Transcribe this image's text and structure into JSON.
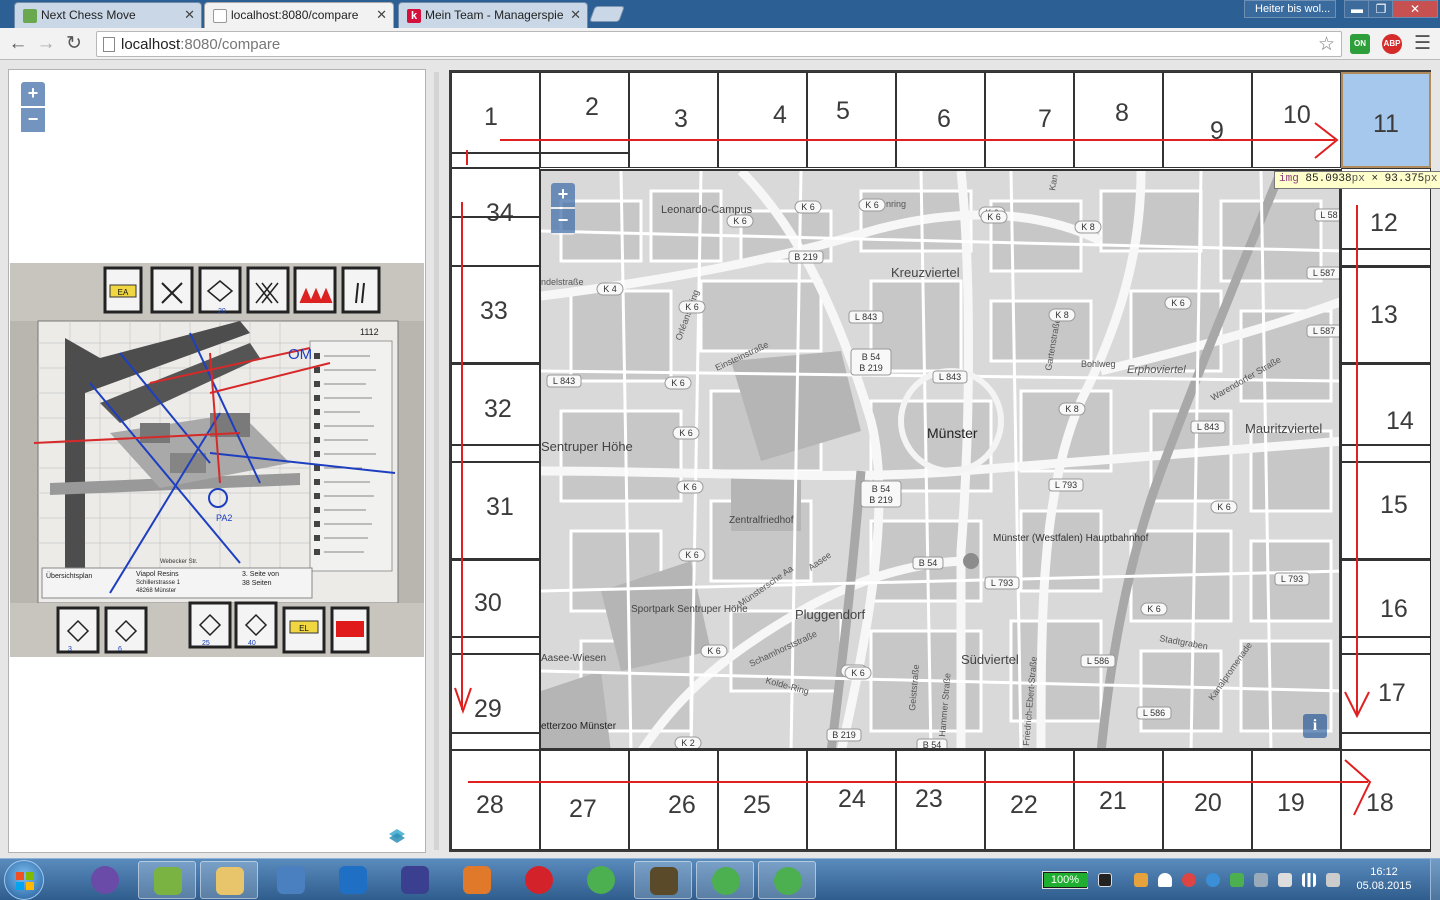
{
  "browser": {
    "tabs": [
      {
        "title": "Next Chess Move",
        "favicon_color": "#6aa84f"
      },
      {
        "title": "localhost:8080/compare",
        "favicon_color": "#ffffff"
      },
      {
        "title": "Mein Team - Managerspie",
        "favicon_color": "#d4113c"
      }
    ],
    "weather": "Heiter bis wol...",
    "window_buttons": {
      "minimize": "▬",
      "maximize": "❐",
      "close": "✕"
    },
    "url_host": "localhost",
    "url_path": ":8080/compare",
    "extensions": [
      "ON",
      "ABP"
    ]
  },
  "left_map": {
    "zoom_in": "+",
    "zoom_out": "−",
    "photo_labels": {
      "plan_number": "1112",
      "overview": "Übersichtsplan",
      "company": "Viapol Resins",
      "street": "Schillerstrasse 1",
      "city": "48268 Münster",
      "page": "3. Seite von",
      "pages": "38 Seiten",
      "card_ea": "EA",
      "card_el": "EL",
      "card_numbers": [
        "20",
        "3",
        "6",
        "25",
        "40"
      ],
      "marker_om": "OM",
      "marker_pa": "PA2",
      "street_label": "Webecker Str."
    }
  },
  "board": {
    "top_numbers": [
      "1",
      "2",
      "3",
      "4",
      "5",
      "6",
      "7",
      "8",
      "9",
      "10",
      "11"
    ],
    "right_numbers": [
      "12",
      "13",
      "14",
      "15",
      "16",
      "17"
    ],
    "bottom_numbers": [
      "28",
      "27",
      "26",
      "25",
      "24",
      "23",
      "22",
      "21",
      "20",
      "19",
      "18"
    ],
    "left_numbers": [
      "34",
      "33",
      "32",
      "31",
      "30",
      "29"
    ],
    "highlight_color": "#a6c8ec",
    "arrow_color": "#e02020"
  },
  "map": {
    "zoom_in": "+",
    "zoom_out": "−",
    "info": "i",
    "places": [
      "Leonardo-Campus",
      "Kreuzviertel",
      "Erphoviertel",
      "Münster",
      "Mauritzviertel",
      "Sentruper Höhe",
      "Zentralfriedhof",
      "Münster (Westfalen) Hauptbahnhof",
      "Sportpark Sentruper Höhe",
      "Pluggendorf",
      "Südviertel",
      "Aasee-Wiesen",
      "etterzoo Münster"
    ],
    "streets": [
      "Friesenring",
      "Bohlweg",
      "Warendorfer Straße",
      "Einsteinstraße",
      "Orléans-Ring",
      "Gartenstraße",
      "Schamhorststraße",
      "Kolde-Ring",
      "Geiststraße",
      "Hammer Straße",
      "Friedrich-Ebert-Straße",
      "Kanalpromenade",
      "Münstersche Aa",
      "Aasee",
      "Stadtgraben",
      "ndelstraße",
      "Kan"
    ],
    "road_labels": [
      "K 6",
      "K 8",
      "K 4",
      "K 2",
      "B 219",
      "B 54",
      "B 54 B 219",
      "L 843",
      "L 587",
      "L 793",
      "L 586",
      "L 58"
    ]
  },
  "devtools_tooltip": {
    "tag": "img",
    "width": "85.0938",
    "height": "93.375",
    "unit": "px",
    "times": "×"
  },
  "taskbar": {
    "apps": [
      "cat-app",
      "notepad-plus",
      "file-explorer",
      "remote-desktop",
      "outlook",
      "eclipse",
      "matlab",
      "opera",
      "chrome",
      "java-ee-ide",
      "chrome",
      "chrome"
    ],
    "battery": "100%",
    "battery_level": 1.0,
    "time": "16:12",
    "date": "05.08.2015"
  }
}
